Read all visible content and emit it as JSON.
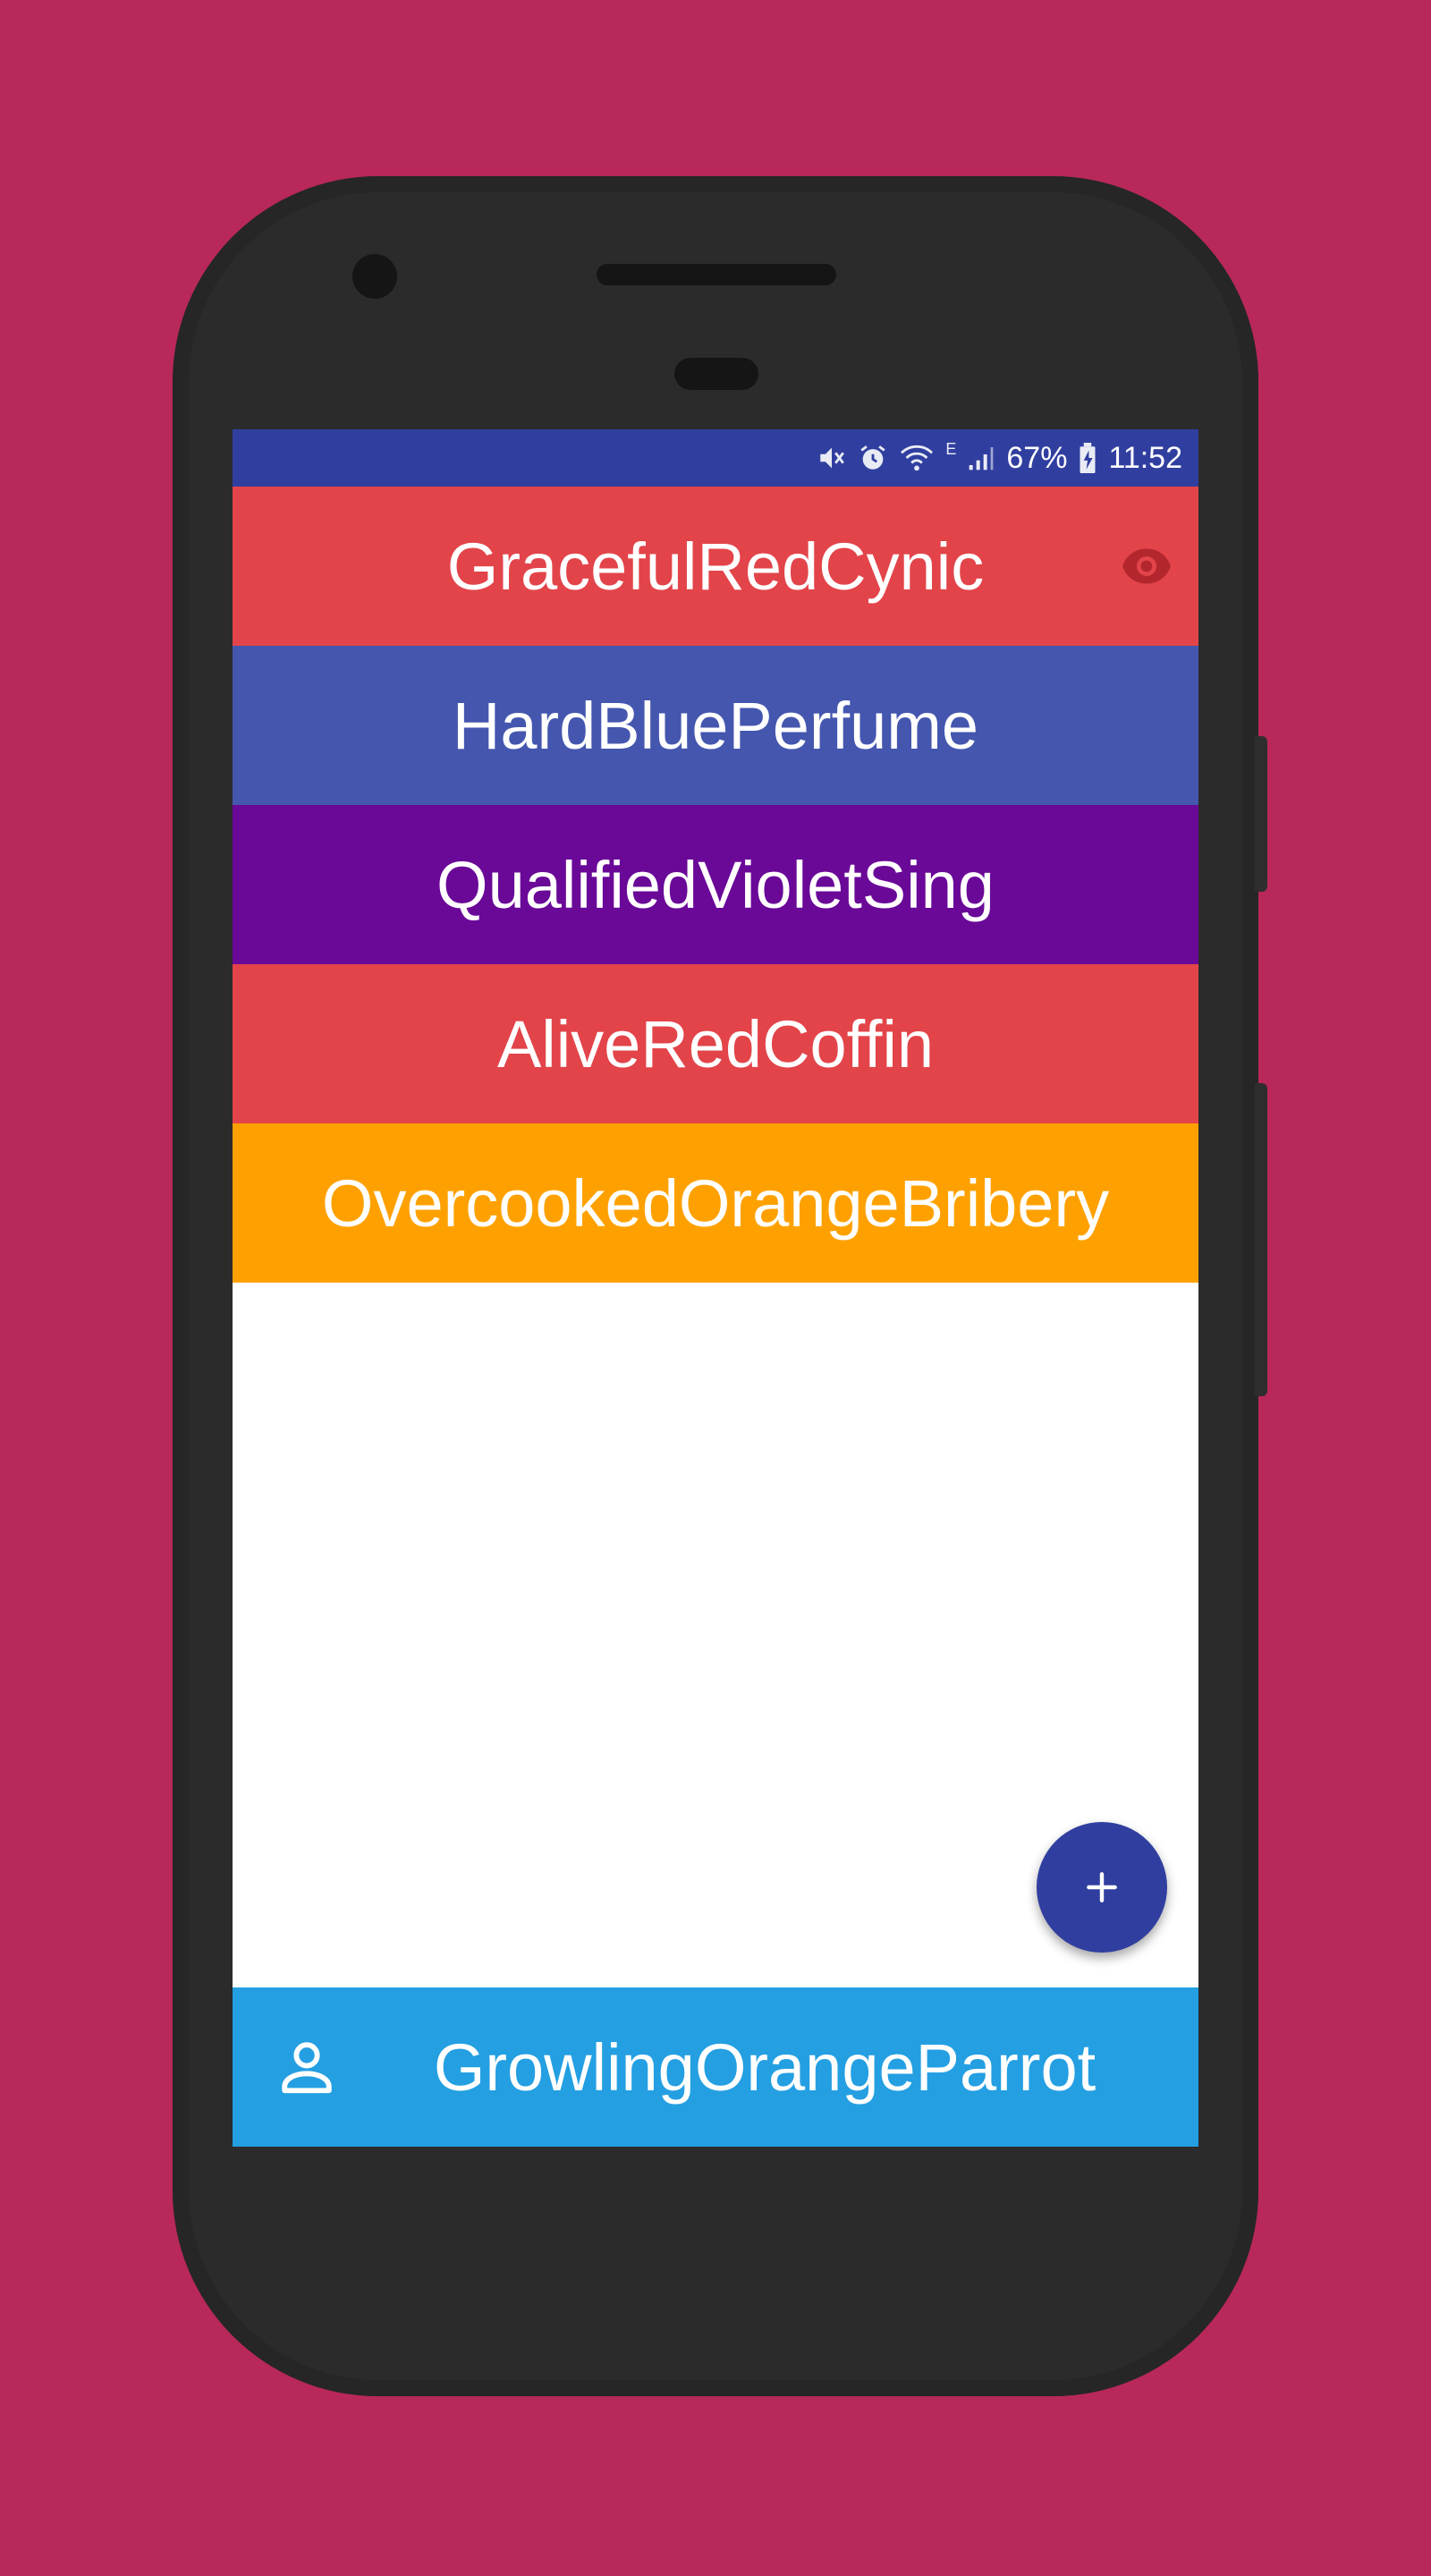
{
  "status_bar": {
    "battery": "67%",
    "time": "11:52",
    "network_type": "E",
    "icons": [
      "mute-icon",
      "alarm-icon",
      "wifi-icon",
      "signal-icon",
      "battery-charging-icon"
    ],
    "color": "#303f9f"
  },
  "list": {
    "items": [
      {
        "label": "GracefulRedCynic",
        "color": "#e2444a",
        "icon": "eye-icon",
        "icon_color": "#b3262d"
      },
      {
        "label": "HardBluePerfume",
        "color": "#4456ae"
      },
      {
        "label": "QualifiedVioletSing",
        "color": "#6a0898"
      },
      {
        "label": "AliveRedCoffin",
        "color": "#e2444a"
      },
      {
        "label": "OvercookedOrangeBribery",
        "color": "#fea100"
      }
    ]
  },
  "fab": {
    "label": "+",
    "icon": "plus-icon",
    "color": "#303f9f"
  },
  "bottom_bar": {
    "label": "GrowlingOrangeParrot",
    "icon": "person-icon",
    "color": "#239fe2"
  },
  "background_color": "#b8285a"
}
